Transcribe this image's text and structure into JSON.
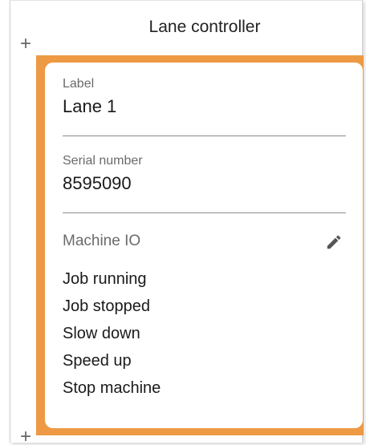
{
  "title": "Lane controller",
  "add_icon_glyph": "+",
  "colors": {
    "selection": "#ee9944",
    "card": "#ffffff"
  },
  "card": {
    "label_field": {
      "label": "Label",
      "value": "Lane 1"
    },
    "serial_field": {
      "label": "Serial number",
      "value": "8595090"
    },
    "machine_io": {
      "title": "Machine IO",
      "edit_icon": "pencil-icon",
      "items": [
        "Job running",
        "Job stopped",
        "Slow down",
        "Speed up",
        "Stop machine"
      ]
    }
  }
}
